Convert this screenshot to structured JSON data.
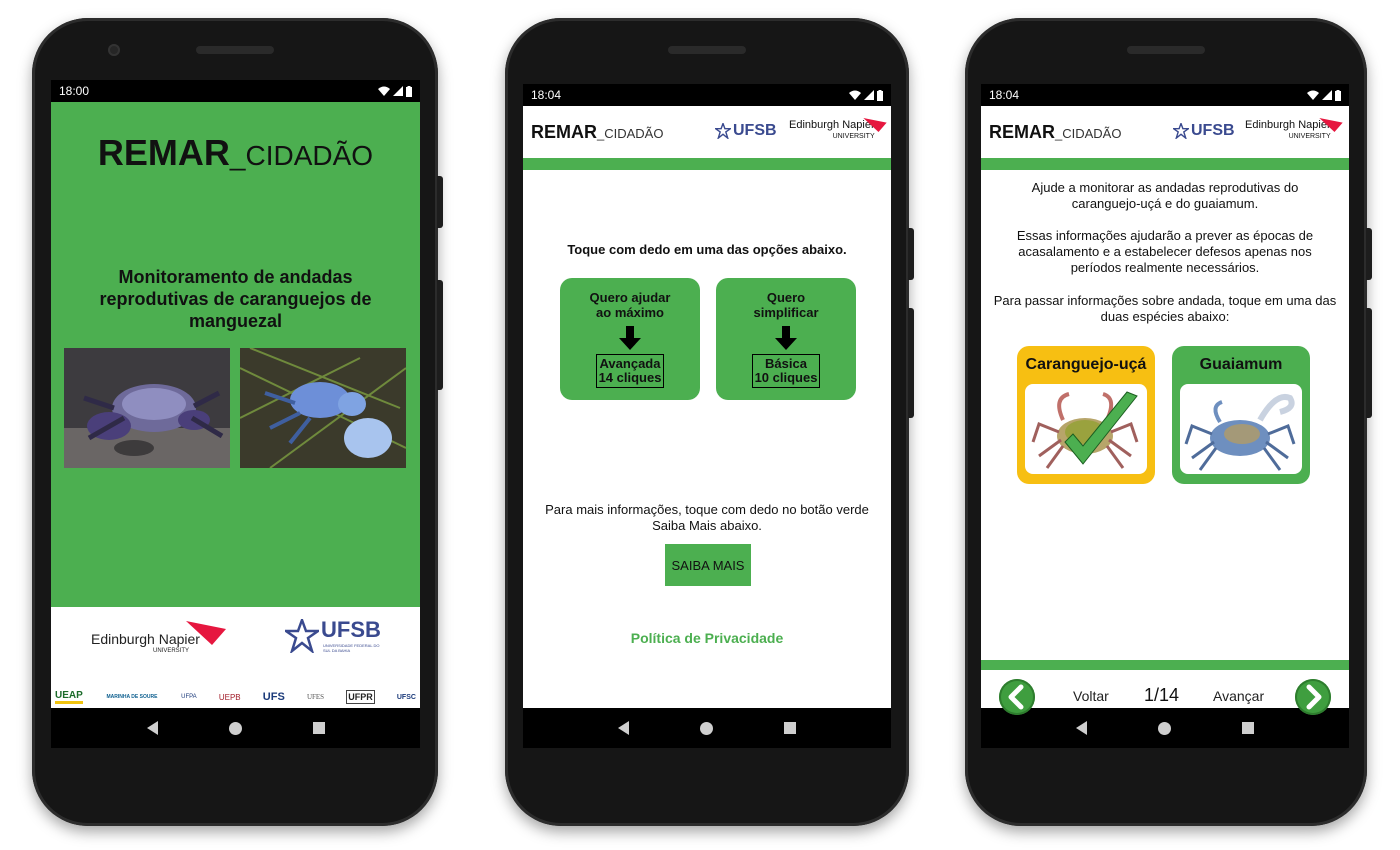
{
  "screen1": {
    "time": "18:00",
    "title_main": "REMAR",
    "title_sub": "_CIDADÃO",
    "heading": "Monitoramento de andadas reprodutivas de caranguejos de manguezal",
    "logo_napier_name": "Edinburgh Napier",
    "logo_napier_univ": "UNIVERSITY",
    "logo_ufsb": "UFSB",
    "logo_ufsb_sub": "UNIVERSIDADE FEDERAL DO SUL DA BAHIA",
    "partner_logos": [
      "UEAP",
      "MARINHA DE SOURE",
      "UFPA",
      "UEPB",
      "UFS",
      "UFES",
      "UFPR",
      "UFSC"
    ]
  },
  "screen2": {
    "time": "18:04",
    "header_title": "REMAR",
    "header_sub": "_CIDADÃO",
    "logo_ufsb": "UFSB",
    "logo_napier_name": "Edinburgh Napier",
    "logo_napier_univ": "UNIVERSITY",
    "prompt": "Toque com dedo em uma das opções abaixo.",
    "option_advanced": {
      "label_line1": "Quero ajudar",
      "label_line2": "ao máximo",
      "box_line1": "Avançada",
      "box_line2": "14 cliques"
    },
    "option_basic": {
      "label_line1": "Quero",
      "label_line2": "simplificar",
      "box_line1": "Básica",
      "box_line2": "10 cliques"
    },
    "info_line1": "Para mais informações, toque com dedo no botão verde",
    "info_line2": "Saiba Mais abaixo.",
    "saiba_mais": "SAIBA MAIS",
    "privacy": "Política de Privacidade"
  },
  "screen3": {
    "time": "18:04",
    "header_title": "REMAR",
    "header_sub": "_CIDADÃO",
    "logo_ufsb": "UFSB",
    "logo_napier_name": "Edinburgh Napier",
    "logo_napier_univ": "UNIVERSITY",
    "para1": "Ajude a monitorar as andadas reprodutivas do caranguejo-uçá e do guaiamum.",
    "para2": "Essas informações ajudarão a prever as épocas de acasalamento e a estabelecer defesos apenas nos períodos realmente necessários.",
    "para3": "Para passar informações sobre andada, toque em uma das duas espécies abaixo:",
    "species_1": "Caranguejo-uçá",
    "species_2": "Guaiamum",
    "back_label": "Voltar",
    "page": "1/14",
    "next_label": "Avançar"
  },
  "colors": {
    "green": "#4caf50",
    "yellow": "#f7bf12",
    "ufsb_blue": "#3a4a8f",
    "napier_red": "#e6173f"
  },
  "icons": [
    "wifi-icon",
    "signal-icon",
    "battery-icon",
    "back-nav-icon",
    "home-nav-icon",
    "recents-nav-icon",
    "arrow-down-icon",
    "checkmark-icon",
    "chevron-left-icon",
    "chevron-right-icon",
    "ufsb-star-icon",
    "napier-swoosh-icon"
  ]
}
